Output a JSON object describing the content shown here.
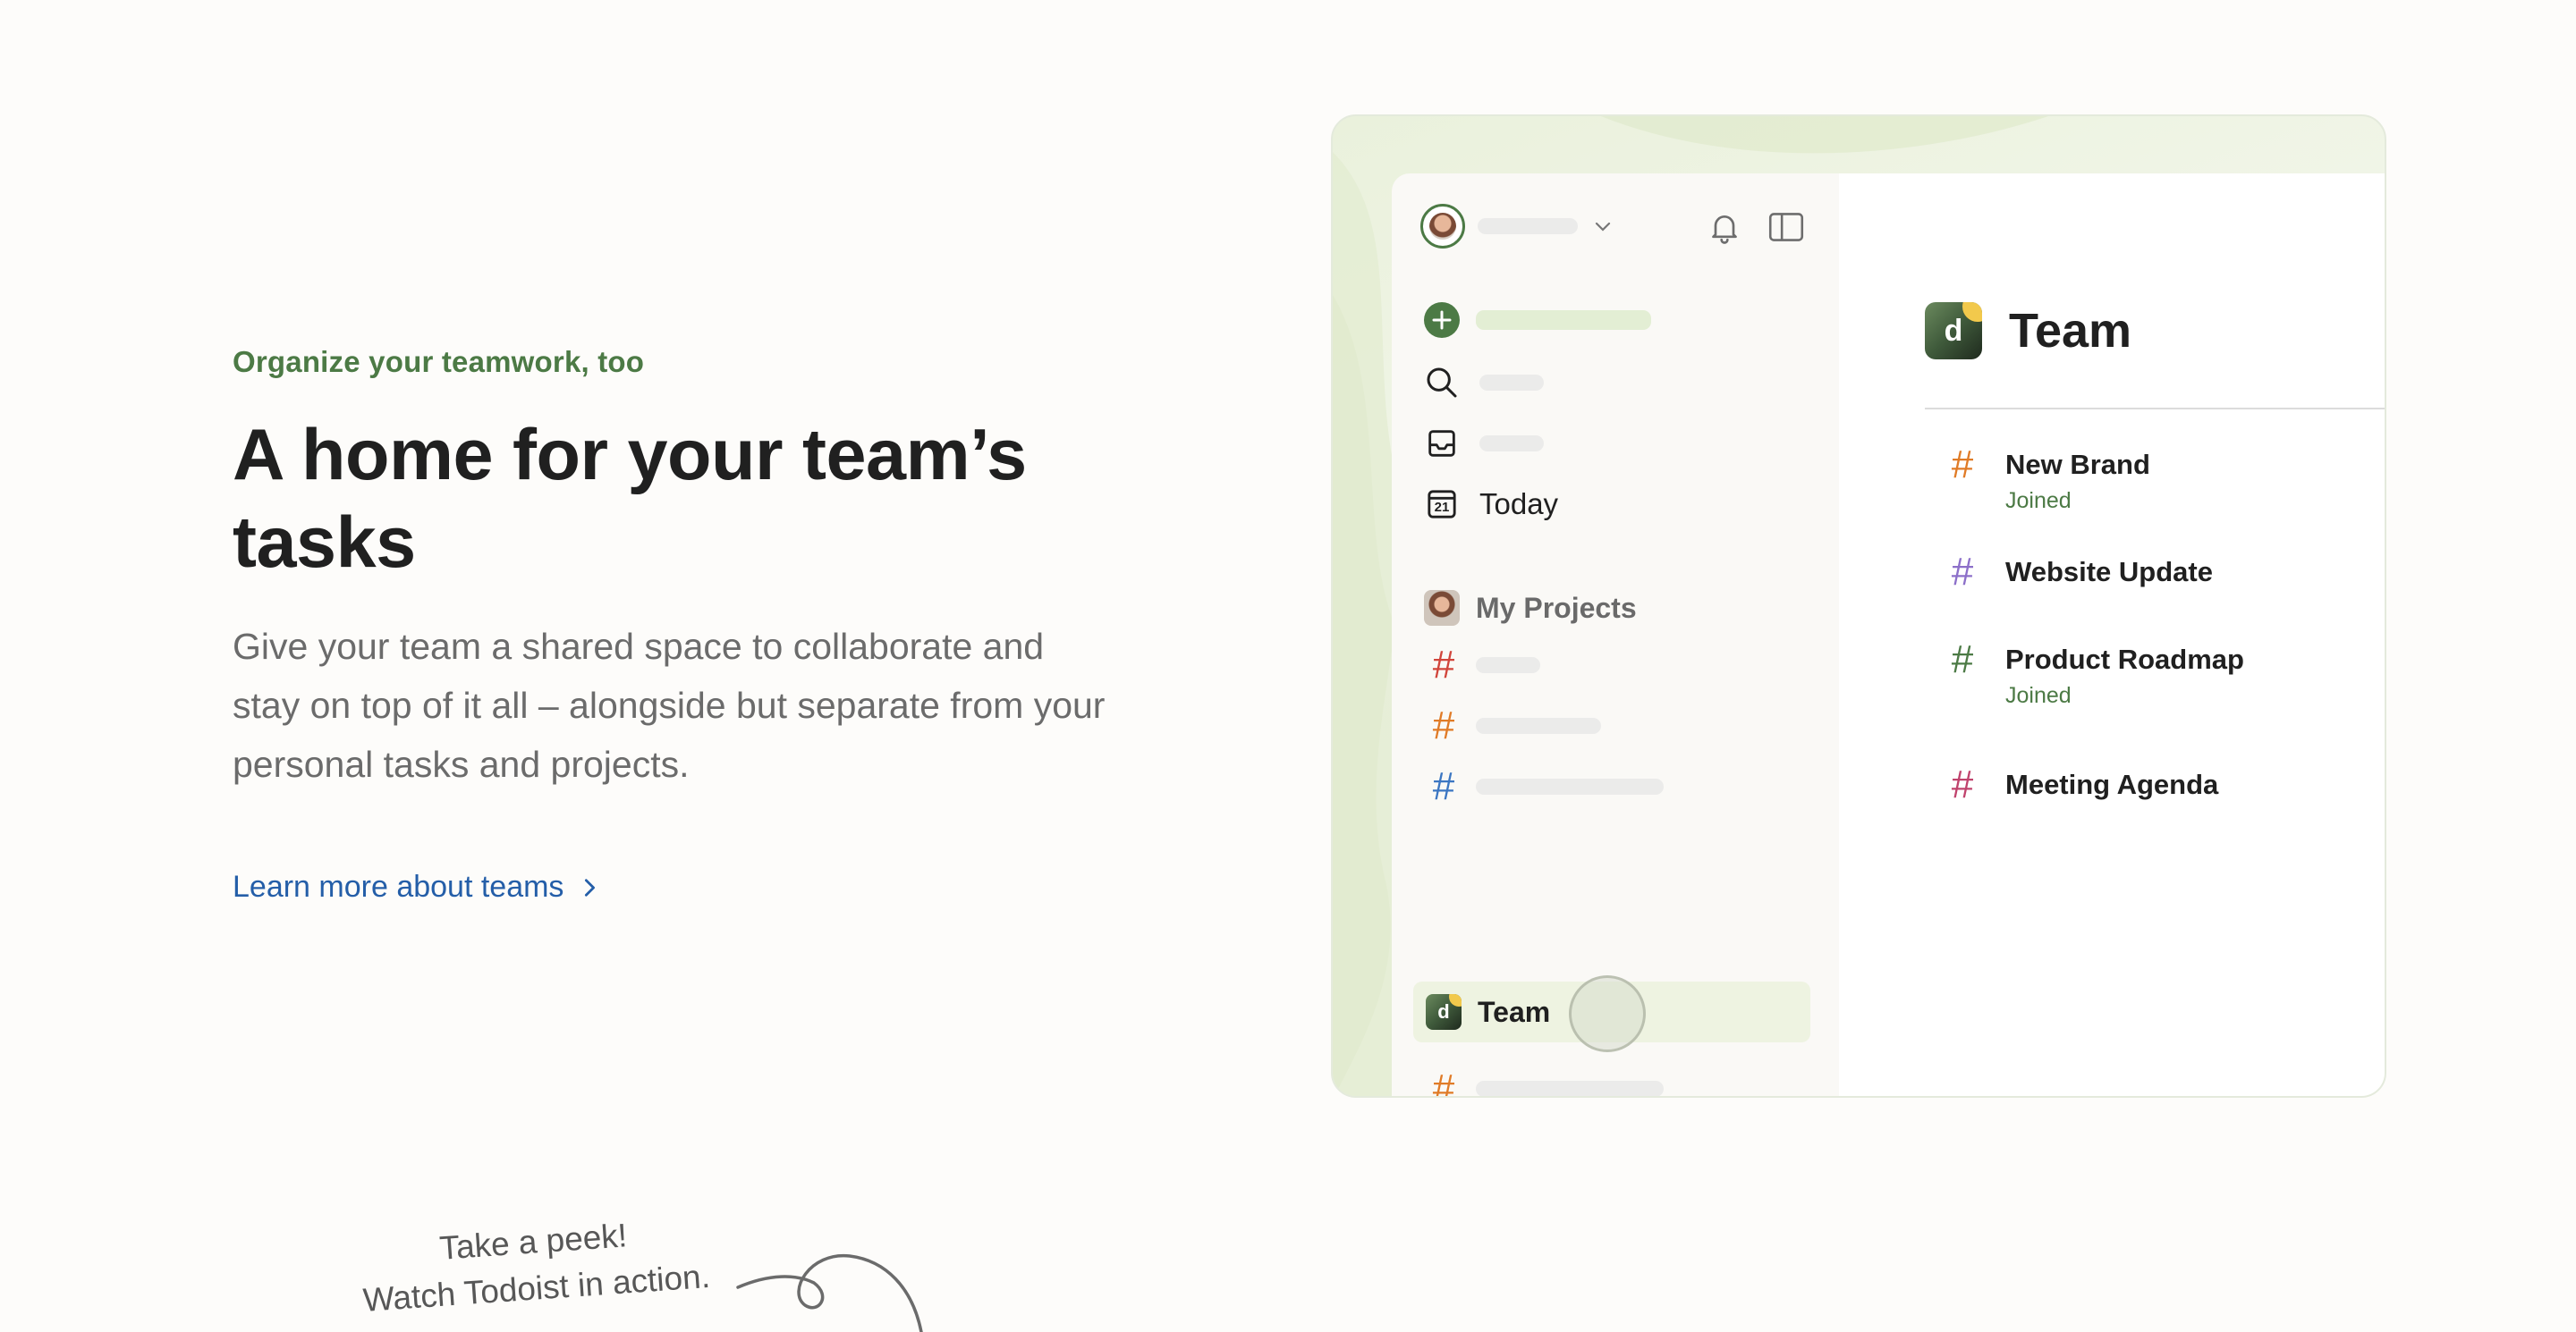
{
  "hero": {
    "eyebrow": "Organize your teamwork, too",
    "headline": "A home for your team’s tasks",
    "body": "Give your team a shared space to collaborate and stay on top of it all – alongside but separate from your personal tasks and projects.",
    "link_label": "Learn more about teams"
  },
  "peek": {
    "line1": "Take a peek!",
    "line2": "Watch Todoist in action."
  },
  "app": {
    "sidebar": {
      "today_label": "Today",
      "today_date": "21",
      "my_projects_label": "My Projects",
      "team_label": "Team",
      "team_logo_letter": "d"
    },
    "main": {
      "title": "Team",
      "logo_letter": "d",
      "projects": [
        {
          "name": "New Brand",
          "status": "Joined",
          "color": "#e07b27"
        },
        {
          "name": "Website Update",
          "status": "",
          "color": "#8c6fc9"
        },
        {
          "name": "Product Roadmap",
          "status": "Joined",
          "color": "#4c7a45"
        },
        {
          "name": "Meeting Agenda",
          "status": "",
          "color": "#c0436d"
        }
      ]
    }
  },
  "colors": {
    "accent_green": "#4c7a45",
    "link_blue": "#245ea8",
    "hash_red": "#d1453b",
    "hash_orange": "#e07b27",
    "hash_blue": "#3b76c2",
    "hash_purple": "#8c6fc9",
    "hash_green": "#4c7a45",
    "hash_pink": "#c0436d"
  }
}
